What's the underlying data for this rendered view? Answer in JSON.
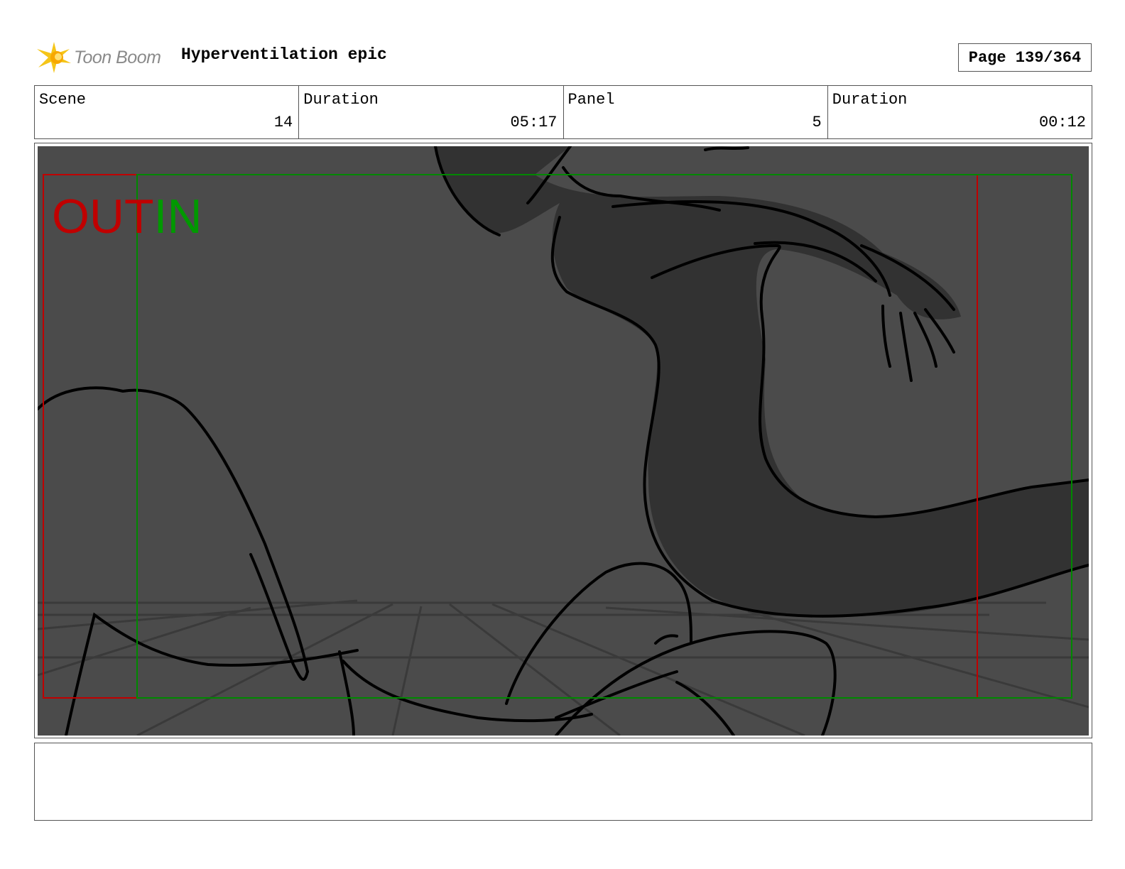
{
  "header": {
    "logo_text": "Toon Boom",
    "title": "Hyperventilation epic",
    "page_label": "Page 139/364"
  },
  "info": {
    "scene_label": "Scene",
    "scene_value": "14",
    "scene_duration_label": "Duration",
    "scene_duration_value": "05:17",
    "panel_label": "Panel",
    "panel_value": "5",
    "panel_duration_label": "Duration",
    "panel_duration_value": "00:12"
  },
  "panel": {
    "out_label": "OUT",
    "in_label": "IN",
    "out_color": "#c00000",
    "in_color": "#009900"
  },
  "notes": {
    "text": ""
  },
  "colors": {
    "background": "#4b4b4b",
    "silhouette": "#323232",
    "line": "#000000"
  }
}
